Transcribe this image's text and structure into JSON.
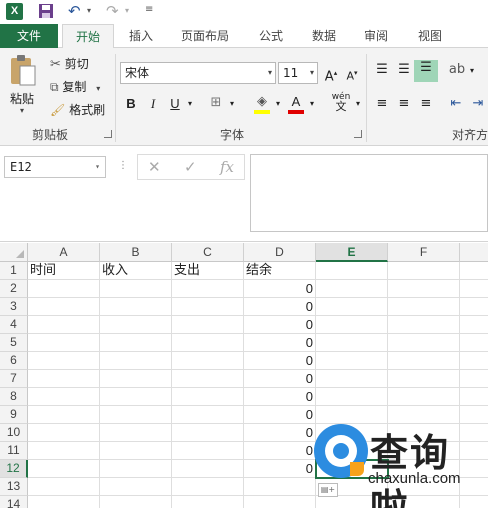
{
  "qat": {
    "app_icon": "X",
    "save_icon": "save-icon",
    "undo_icon": "undo-icon",
    "redo_icon": "redo-icon",
    "customize_icon": "customize-icon"
  },
  "tabs": [
    "文件",
    "开始",
    "插入",
    "页面布局",
    "公式",
    "数据",
    "审阅",
    "视图"
  ],
  "active_tab": "开始",
  "ribbon": {
    "clipboard": {
      "paste": "粘贴",
      "cut": "剪切",
      "copy": "复制",
      "format_painter": "格式刷",
      "label": "剪贴板"
    },
    "font": {
      "name": "宋体",
      "size": "11",
      "grow": "A",
      "shrink": "A",
      "bold": "B",
      "italic": "I",
      "underline": "U",
      "phonetic": "wén",
      "label": "字体"
    },
    "alignment": {
      "label": "对齐方"
    }
  },
  "formula_bar": {
    "name_box": "E12",
    "cancel": "✕",
    "enter": "✓",
    "fx": "fx",
    "content": ""
  },
  "sheet": {
    "columns": [
      "A",
      "B",
      "C",
      "D",
      "E",
      "F"
    ],
    "selected_column": "E",
    "rows": [
      "1",
      "2",
      "3",
      "4",
      "5",
      "6",
      "7",
      "8",
      "9",
      "10",
      "11",
      "12",
      "13",
      "14"
    ],
    "selected_row": "12",
    "headers": [
      "时间",
      "收入",
      "支出",
      "结余"
    ],
    "d_values": [
      "0",
      "0",
      "0",
      "0",
      "0",
      "0",
      "0",
      "0",
      "0",
      "0",
      "0"
    ]
  },
  "watermark": {
    "cn": "查询啦",
    "en": "chaxunla.com"
  },
  "colors": {
    "accent": "#217346",
    "watermark_blue": "#2c8ce0",
    "watermark_orange": "#f7a21b"
  }
}
